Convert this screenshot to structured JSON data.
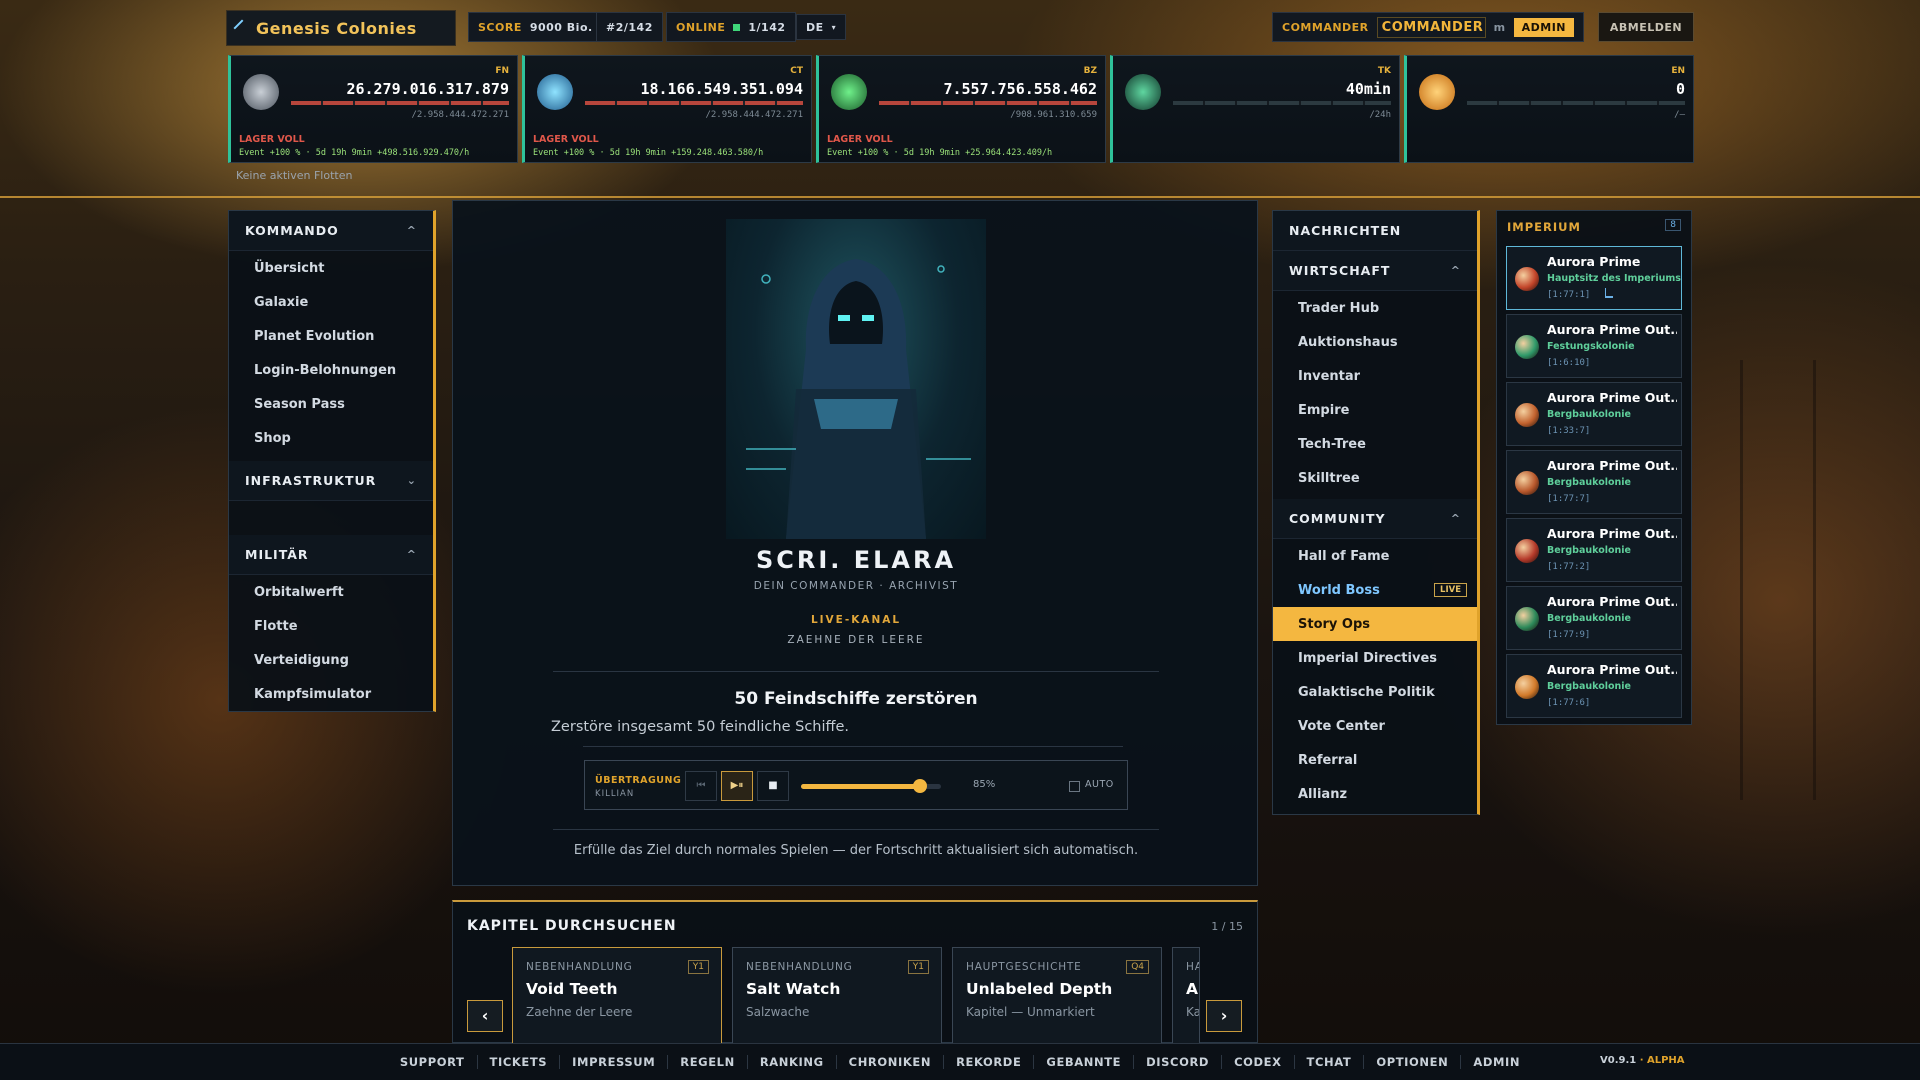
{
  "header": {
    "title": "Genesis Colonies",
    "score_label": "SCORE",
    "score_value": "9000 Bio.",
    "rank": "#2/142",
    "online_label": "ONLINE",
    "online_value": "1/142",
    "language": "DE",
    "commander_label": "COMMANDER",
    "commander_name": "COMMANDER ...",
    "commander_tag": "m",
    "admin_badge": "ADMIN",
    "logout_label": "ABMELDEN"
  },
  "resources": [
    {
      "tag": "FN",
      "value": "26.279.016.317.879",
      "capacity": "/2.958.444.472.271",
      "status": "LAGER VOLL",
      "event": "Event +100 % · 5d 19h 9min  +498.516.929.470/h",
      "icon": "metal-ore-icon"
    },
    {
      "tag": "CT",
      "value": "18.166.549.351.094",
      "capacity": "/2.958.444.472.271",
      "status": "LAGER VOLL",
      "event": "Event +100 % · 5d 19h 9min  +159.248.463.580/h",
      "icon": "crystal-icon"
    },
    {
      "tag": "BZ",
      "value": "7.557.756.558.462",
      "capacity": "/908.961.310.659",
      "status": "LAGER VOLL",
      "event": "Event +100 % · 5d 19h 9min  +25.964.423.409/h",
      "icon": "fuel-canister-icon"
    },
    {
      "tag": "TK",
      "value": "40min",
      "capacity": "/24h",
      "status": "",
      "event": "",
      "icon": "alien-skull-icon"
    },
    {
      "tag": "EN",
      "value": "0",
      "capacity": "/—",
      "status": "",
      "event": "",
      "icon": "energy-sun-icon"
    }
  ],
  "fleet_status": "Keine aktiven Flotten",
  "left_nav": {
    "sections": [
      {
        "title": "KOMMANDO",
        "chevron": "^",
        "items": [
          "Übersicht",
          "Galaxie",
          "Planet Evolution",
          "Login-Belohnungen",
          "Season Pass",
          "Shop"
        ]
      },
      {
        "title": "INFRASTRUKTUR",
        "chevron": "⌄",
        "items": []
      },
      {
        "title": "MILITÄR",
        "chevron": "^",
        "items": [
          "Orbitalwerft",
          "Flotte",
          "Verteidigung",
          "Kampfsimulator"
        ]
      }
    ]
  },
  "story": {
    "character_name": "SCRI. ELARA",
    "character_role": "DEIN COMMANDER · ARCHIVIST",
    "channel_label": "LIVE-KANAL",
    "channel_name": "ZAEHNE DER LEERE",
    "mission_title": "50 Feindschiffe zerstören",
    "mission_desc": "Zerstöre insgesamt 50 feindliche Schiffe.",
    "transmission_label": "ÜBERTRAGUNG",
    "transmission_source": "KILLIAN",
    "volume": 85,
    "volume_text": "85%",
    "auto_label": "AUTO",
    "hint": "Erfülle das Ziel durch normales Spielen — der Fortschritt aktualisiert sich automatisch."
  },
  "chapters": {
    "title": "KAPITEL DURCHSUCHEN",
    "pager": "1 / 15",
    "cards": [
      {
        "kind": "NEBENHANDLUNG",
        "badge": "Y1",
        "title": "Void Teeth",
        "subtitle": "Zaehne der Leere"
      },
      {
        "kind": "NEBENHANDLUNG",
        "badge": "Y1",
        "title": "Salt Watch",
        "subtitle": "Salzwache"
      },
      {
        "kind": "HAUPTGESCHICHTE",
        "badge": "Q4",
        "title": "Unlabeled Depth",
        "subtitle": "Kapitel — Unmarkiert"
      },
      {
        "kind": "HA",
        "badge": "",
        "title": "A",
        "subtitle": "Ka"
      }
    ]
  },
  "right_nav": {
    "news": "NACHRICHTEN",
    "sections": [
      {
        "title": "WIRTSCHAFT",
        "items": [
          "Trader Hub",
          "Auktionshaus",
          "Inventar",
          "Empire",
          "Tech-Tree",
          "Skilltree"
        ]
      },
      {
        "title": "COMMUNITY",
        "items": [
          "Hall of Fame",
          "World Boss",
          "Story Ops",
          "Imperial Directives",
          "Galaktische Politik",
          "Vote Center",
          "Referral",
          "Allianz"
        ]
      }
    ],
    "live_badge": "LIVE"
  },
  "empire": {
    "title": "IMPERIUM",
    "count": "8",
    "planets": [
      {
        "name": "Aurora Prime",
        "type": "Hauptsitz des Imperiums",
        "coords": "[1:77:1]",
        "color": "#c3452a"
      },
      {
        "name": "Aurora Prime Out...",
        "type": "Festungskolonie",
        "coords": "[1:6:10]",
        "color": "#2f9a6a"
      },
      {
        "name": "Aurora Prime Out...",
        "type": "Bergbaukolonie",
        "coords": "[1:33:7]",
        "color": "#c2622e"
      },
      {
        "name": "Aurora Prime Out...",
        "type": "Bergbaukolonie",
        "coords": "[1:77:7]",
        "color": "#b8582c"
      },
      {
        "name": "Aurora Prime Out...",
        "type": "Bergbaukolonie",
        "coords": "[1:77:2]",
        "color": "#b53a2a"
      },
      {
        "name": "Aurora Prime Out...",
        "type": "Bergbaukolonie",
        "coords": "[1:77:9]",
        "color": "#2d8a5a"
      },
      {
        "name": "Aurora Prime Out...",
        "type": "Bergbaukolonie",
        "coords": "[1:77:6]",
        "color": "#d27a2a"
      }
    ]
  },
  "footer": {
    "links": [
      "SUPPORT",
      "TICKETS",
      "IMPRESSUM",
      "REGELN",
      "RANKING",
      "CHRONIKEN",
      "REKORDE",
      "GEBANNTE",
      "DISCORD",
      "CODEX",
      "TCHAT",
      "OPTIONEN",
      "ADMIN"
    ],
    "version": "V0.9.1",
    "stage": "ALPHA"
  },
  "colors": {
    "accent": "#f4b740",
    "panel": "#0a1016",
    "success": "#2fc29a",
    "danger": "#e0574a"
  }
}
